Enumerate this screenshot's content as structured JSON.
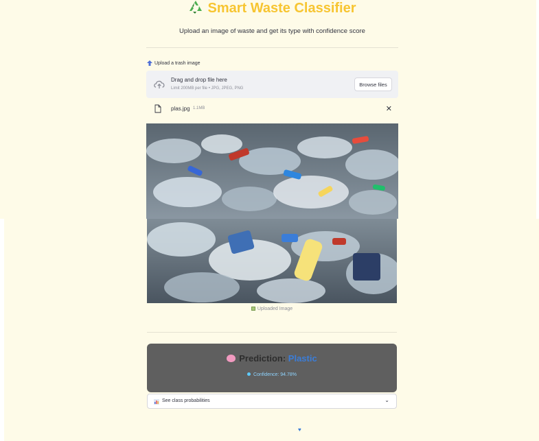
{
  "header": {
    "title": "Smart Waste Classifier",
    "title_icon": "recycle-icon",
    "subtitle": "Upload an image of waste and get its type with confidence score"
  },
  "uploader": {
    "label": "Upload a trash image",
    "label_icon": "upload-arrow-icon",
    "drop_title": "Drag and drop file here",
    "drop_limit": "Limit 200MB per file • JPG, JPEG, PNG",
    "browse_label": "Browse files",
    "file": {
      "name": "plas.jpg",
      "size": "1.1MB",
      "close_glyph": "✕"
    }
  },
  "image": {
    "caption": "Uploaded Image",
    "caption_icon": "image-icon"
  },
  "prediction": {
    "label": "Prediction:",
    "value": "Plastic",
    "icon": "brain-icon",
    "confidence_text": "Confidence: 94.78%"
  },
  "probabilities": {
    "label": "See class probabilities",
    "icon": "bar-chart-icon"
  },
  "footer": {
    "heart": "♥"
  },
  "colors": {
    "background": "#fefbe8",
    "title": "#f7c531",
    "prediction_box": "#5f5f5f",
    "prediction_value": "#3b7dd8",
    "confidence": "#8fd4ff"
  }
}
